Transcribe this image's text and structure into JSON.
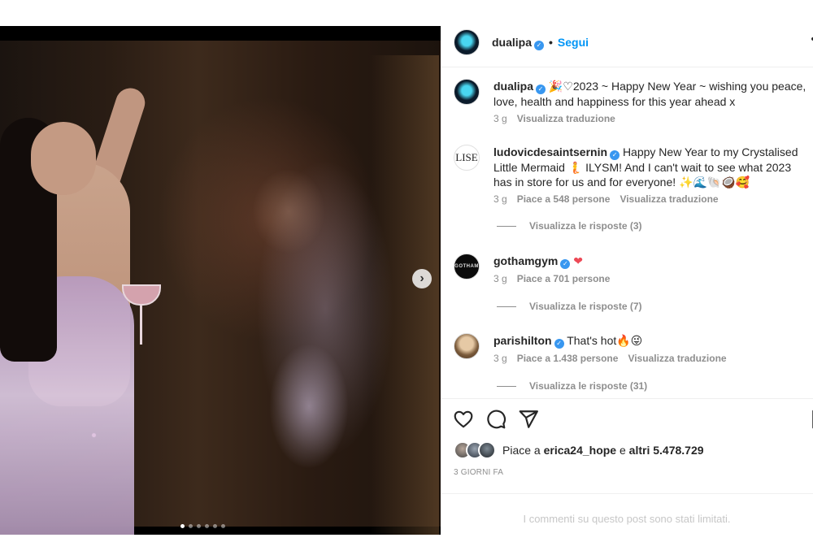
{
  "post": {
    "carousel": {
      "slide_count": 6,
      "active_index": 0
    }
  },
  "header": {
    "username": "dualipa",
    "separator": "•",
    "follow_label": "Segui",
    "more_label": "•"
  },
  "comments": [
    {
      "username": "dualipa",
      "text": "🎉♡2023 ~ Happy New Year ~ wishing you peace, love, health and happiness for this year ahead x",
      "time": "3 g",
      "likes": "",
      "translate": "Visualizza traduzione",
      "replies": ""
    },
    {
      "username": "ludovicdesaintsernin",
      "avatar_text": "LISE",
      "text": "Happy New Year to my Crystalised Little Mermaid 🧜 ILYSM! And I can't wait to see what 2023 has in store for us and for everyone! ✨🌊🐚🥥🥰",
      "time": "3 g",
      "likes": "Piace a 548 persone",
      "translate": "Visualizza traduzione",
      "replies": "Visualizza le risposte (3)"
    },
    {
      "username": "gothamgym",
      "avatar_text": "GOTHAM",
      "text": "❤",
      "time": "3 g",
      "likes": "Piace a 701 persone",
      "translate": "",
      "replies": "Visualizza le risposte (7)"
    },
    {
      "username": "parishilton",
      "text": "That's hot🔥😜",
      "time": "3 g",
      "likes": "Piace a 1.438 persone",
      "translate": "Visualizza traduzione",
      "replies": "Visualizza le risposte (31)"
    }
  ],
  "likes": {
    "prefix": "Piace a ",
    "user": "erica24_hope",
    "middle": " e ",
    "others": "altri 5.478.729"
  },
  "date": "3 GIORNI FA",
  "limited_text": "I commenti su questo post sono stati limitati.",
  "icons": [
    "heart-icon",
    "comment-icon",
    "share-icon",
    "bookmark-icon",
    "chevron-right-icon",
    "verified-icon"
  ],
  "colors": {
    "accent": "#0095f6",
    "verified": "#3897f0",
    "muted": "#8e8e8e"
  }
}
